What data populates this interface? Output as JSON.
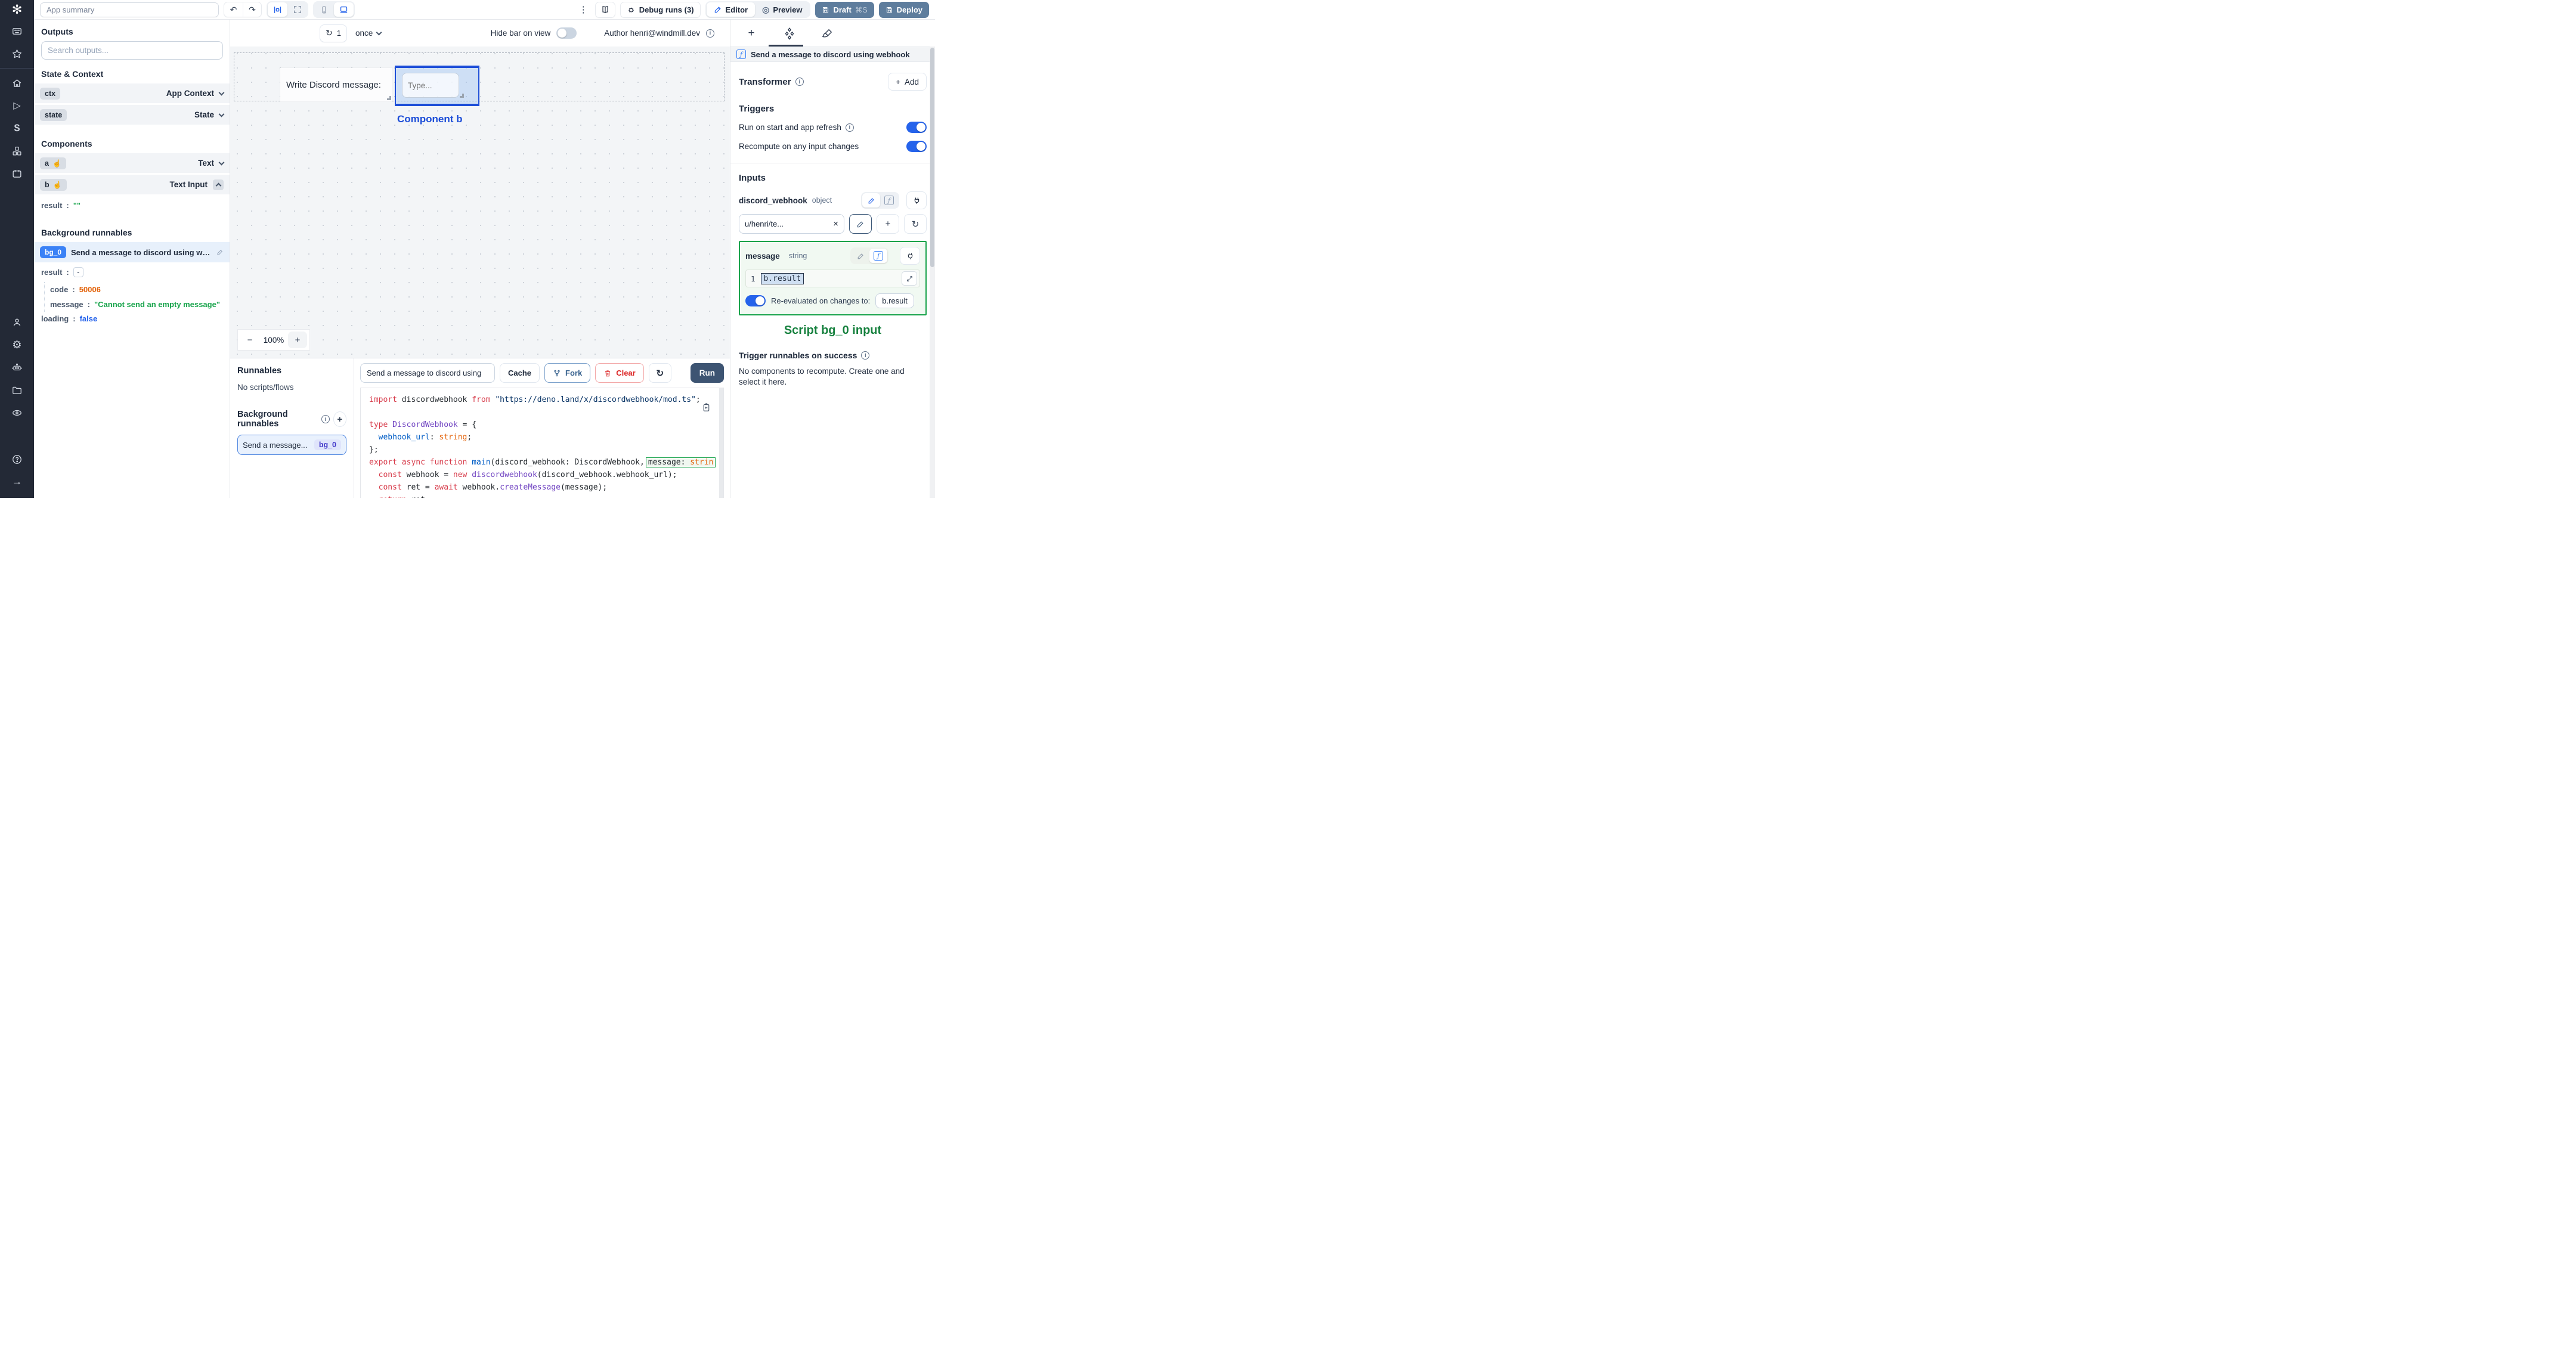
{
  "icons": {
    "logo": "✻",
    "undo": "↶",
    "redo": "↷",
    "kebab": "⋮",
    "refresh": "↻",
    "home": "⌂",
    "play": "▷",
    "dollar": "$",
    "gear": "⚙",
    "arrow_right": "→",
    "hand": "☝",
    "close": "×",
    "plus": "+",
    "minus": "−",
    "preview_eye": "◎",
    "fn": "ƒ"
  },
  "colors": {
    "accent_blue": "#2563eb",
    "selection_blue": "#1d4ed8",
    "success_green": "#16a34a",
    "draft_button": "#5e7d9d",
    "run_button": "#3d5472",
    "error_orange": "#e36209",
    "bool_blue": "#2563eb",
    "rail_bg": "#232936"
  },
  "topbar": {
    "app_summary_placeholder": "App summary",
    "debug_runs": "Debug runs (3)",
    "editor": "Editor",
    "preview": "Preview",
    "draft": "Draft",
    "draft_shortcut": "⌘S",
    "deploy": "Deploy"
  },
  "canvas_bar": {
    "refresh_count": "1",
    "mode": "once",
    "hide_bar_label": "Hide bar on view",
    "author": "Author henri@windmill.dev"
  },
  "canvas": {
    "text_component": "Write Discord message:",
    "input_placeholder": "Type...",
    "selected_label": "Component b",
    "zoom_out": "−",
    "zoom_value": "100%",
    "zoom_in": "+"
  },
  "outputs": {
    "title": "Outputs",
    "search_placeholder": "Search outputs...",
    "state_context_title": "State & Context",
    "ctx_key": "ctx",
    "ctx_type": "App Context",
    "state_key": "state",
    "state_type": "State",
    "components_title": "Components",
    "a_key": "a",
    "a_type": "Text",
    "b_key": "b",
    "b_type": "Text Input",
    "colon": ":",
    "b_result_key": "result",
    "b_result_value": "\"\"",
    "bg_title": "Background runnables",
    "bg_badge": "bg_0",
    "bg_name": "Send a message to discord using webhook",
    "res_key": "result",
    "res_collapse": "-",
    "code_key": "code",
    "code_value": "50006",
    "msg_key": "message",
    "msg_value": "\"Cannot send an empty message\"",
    "loading_key": "loading",
    "loading_value": "false"
  },
  "runnables": {
    "title": "Runnables",
    "empty": "No scripts/flows",
    "bg_title": "Background runnables",
    "item_name": "Send a message...",
    "item_badge": "bg_0"
  },
  "editor_toolbar": {
    "script_name": "Send a message to discord using",
    "cache": "Cache",
    "fork": "Fork",
    "clear": "Clear",
    "run": "Run"
  },
  "code_editor": {
    "lines": [
      [
        {
          "t": "import",
          "c": "k"
        },
        {
          "t": " discordwebhook ",
          "c": "p"
        },
        {
          "t": "from",
          "c": "k"
        },
        {
          "t": " ",
          "c": "p"
        },
        {
          "t": "\"https://deno.land/x/discordwebhook/mod.ts\"",
          "c": "s"
        },
        {
          "t": ";",
          "c": "p"
        }
      ],
      [],
      [
        {
          "t": "type",
          "c": "k"
        },
        {
          "t": " ",
          "c": "p"
        },
        {
          "t": "DiscordWebhook",
          "c": "t"
        },
        {
          "t": " = {",
          "c": "p"
        }
      ],
      [
        {
          "t": "  ",
          "c": "p"
        },
        {
          "t": "webhook_url",
          "c": "v"
        },
        {
          "t": ": ",
          "c": "p"
        },
        {
          "t": "string",
          "c": "o"
        },
        {
          "t": ";",
          "c": "p"
        }
      ],
      [
        {
          "t": "};",
          "c": "p"
        }
      ],
      [
        {
          "t": "export",
          "c": "k"
        },
        {
          "t": " ",
          "c": "p"
        },
        {
          "t": "async",
          "c": "k"
        },
        {
          "t": " ",
          "c": "p"
        },
        {
          "t": "function",
          "c": "k"
        },
        {
          "t": " ",
          "c": "p"
        },
        {
          "t": "main",
          "c": "fn"
        },
        {
          "t": "(discord_webhook: DiscordWebhook,",
          "c": "p"
        },
        {
          "parts": [
            {
              "t": "message: ",
              "c": "p"
            },
            {
              "t": "strin",
              "c": "o"
            }
          ]
        }
      ],
      [
        {
          "t": "  ",
          "c": "p"
        },
        {
          "t": "const",
          "c": "k"
        },
        {
          "t": " webhook = ",
          "c": "p"
        },
        {
          "t": "new",
          "c": "k"
        },
        {
          "t": " ",
          "c": "p"
        },
        {
          "t": "discordwebhook",
          "c": "t"
        },
        {
          "t": "(discord_webhook.webhook_url);",
          "c": "p"
        }
      ],
      [
        {
          "t": "  ",
          "c": "p"
        },
        {
          "t": "const",
          "c": "k"
        },
        {
          "t": " ret = ",
          "c": "p"
        },
        {
          "t": "await",
          "c": "k"
        },
        {
          "t": " webhook.",
          "c": "p"
        },
        {
          "t": "createMessage",
          "c": "t"
        },
        {
          "t": "(message);",
          "c": "p"
        }
      ],
      [
        {
          "t": "  ",
          "c": "p"
        },
        {
          "t": "return",
          "c": "k"
        },
        {
          "t": " ret;",
          "c": "p"
        }
      ],
      [
        {
          "t": "}",
          "c": "p"
        }
      ]
    ]
  },
  "right_panel": {
    "header_title": "Send a message to discord using webhook",
    "transformer_label": "Transformer",
    "add_label": "Add",
    "triggers_title": "Triggers",
    "trigger_run_on_start": "Run on start and app refresh",
    "trigger_recompute": "Recompute on any input changes",
    "inputs_title": "Inputs",
    "input1_name": "discord_webhook",
    "input1_type": "object",
    "input1_value": "u/henri/te...",
    "input2_name": "message",
    "input2_type": "string",
    "expr_line_no": "1",
    "expr_value": "b.result",
    "reeval_label": "Re-evaluated on changes to:",
    "reeval_target": "b.result",
    "annotation": "Script bg_0 input",
    "trigger_success_title": "Trigger runnables on success",
    "no_components_text": "No components to recompute. Create one and select it here."
  }
}
